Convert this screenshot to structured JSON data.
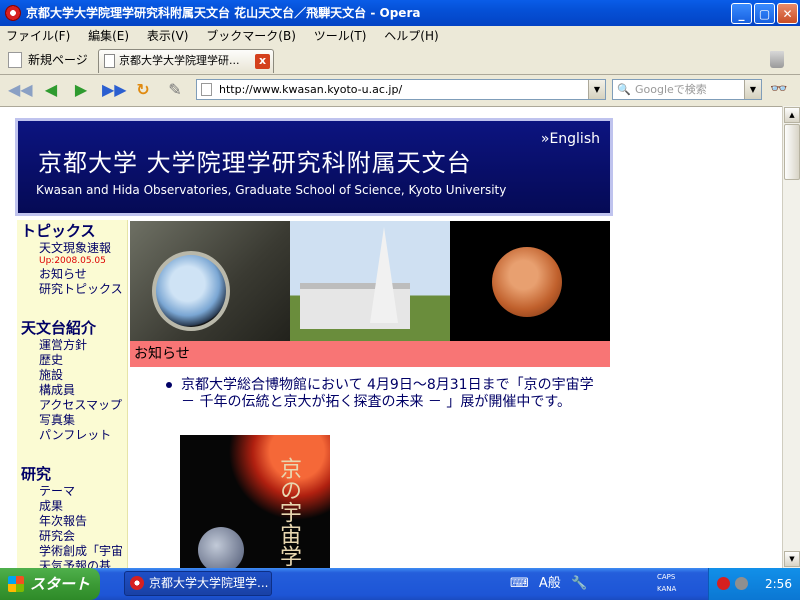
{
  "window": {
    "title": "京都大学大学院理学研究科附属天文台 花山天文台／飛騨天文台 - Opera",
    "min_label": "_",
    "max_label": "▢",
    "close_label": "✕"
  },
  "menu": [
    "ファイル(F)",
    "編集(E)",
    "表示(V)",
    "ブックマーク(B)",
    "ツール(T)",
    "ヘルプ(H)"
  ],
  "tabs": {
    "new_page": "新規ページ",
    "active_tab": "京都大学大学院理学研...",
    "close": "x"
  },
  "toolbar": {
    "back": "◀◀",
    "forward": "▶",
    "forward2": "▶",
    "fast_forward": "▶▶",
    "reload": "↻",
    "edit": "✎",
    "address_value": "http://www.kwasan.kyoto-u.ac.jp/",
    "search_placeholder": "Googleで検索",
    "dropdown_arrow": "▼",
    "glasses": "👓"
  },
  "banner": {
    "jp_title": "京都大学 大学院理学研究科附属天文台",
    "en_subtitle": "Kwasan and Hida Observatories, Graduate School of Science, Kyoto University",
    "english_link": "»English"
  },
  "sidebar": {
    "topics": {
      "heading": "トピックス",
      "items": [
        "天文現象速報",
        "お知らせ",
        "研究トピックス"
      ],
      "updated": "Up:2008.05.05"
    },
    "about": {
      "heading": "天文台紹介",
      "items": [
        "運営方針",
        "歴史",
        "施設",
        "構成員",
        "アクセスマップ",
        "写真集",
        "パンフレット"
      ]
    },
    "research": {
      "heading": "研究",
      "items": [
        "テーマ",
        "成果",
        "年次報告",
        "研究会",
        "学術創成「宇宙",
        "天気予報の基"
      ]
    }
  },
  "content": {
    "notice_heading": "お知らせ",
    "news_item": "京都大学総合博物館において 4月9日～8月31日まで「京の宇宙学 － 千年の伝統と京大が拓く探査の未来 － 」展が開催中です。",
    "poster_text": "京の宇宙学"
  },
  "taskbar": {
    "start_label": "スタート",
    "task_label": "京都大学大学院理学...",
    "ime_mode": "A般",
    "caps": "CAPS",
    "kana": "KANA",
    "clock": "2:56"
  }
}
